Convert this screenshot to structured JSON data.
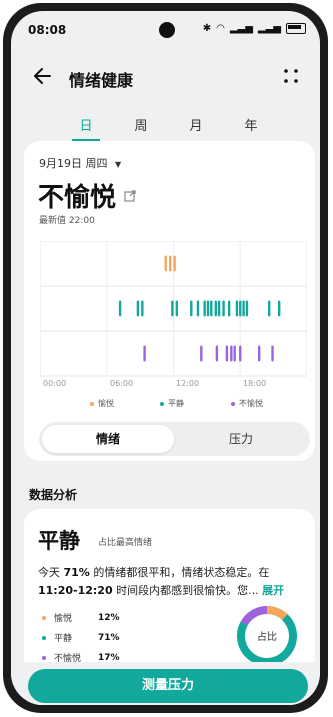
{
  "status_bar": {
    "time": "08:08"
  },
  "header": {
    "title": "情绪健康",
    "back_icon": "arrow-left-icon",
    "more_icon": "more-dots-icon"
  },
  "tabs": [
    {
      "label": "日",
      "active": true
    },
    {
      "label": "周",
      "active": false
    },
    {
      "label": "月",
      "active": false
    },
    {
      "label": "年",
      "active": false
    }
  ],
  "summary": {
    "date": "9月19日 周四",
    "mood": "不愉悦",
    "latest": "最新值 22:00"
  },
  "chart_data": {
    "type": "scatter",
    "x_ticks": [
      "00:00",
      "06:00",
      "12:00",
      "18:00"
    ],
    "series": [
      {
        "name": "愉悦",
        "color": "#f4a65a",
        "times_hours": [
          11.3,
          11.7,
          12.1
        ]
      },
      {
        "name": "平静",
        "color": "#12a89b",
        "times_hours": [
          7.2,
          8.8,
          9.2,
          11.9,
          12.3,
          13.6,
          14.2,
          14.8,
          15.1,
          15.4,
          15.8,
          16.1,
          16.5,
          17.0,
          17.7,
          18.0,
          18.3,
          18.6,
          20.6,
          21.5
        ]
      },
      {
        "name": "不愉悦",
        "color": "#9b63dc",
        "times_hours": [
          9.4,
          14.5,
          15.9,
          16.8,
          17.2,
          17.5,
          18.0,
          19.7,
          20.9
        ]
      }
    ]
  },
  "legend": [
    {
      "label": "愉悦",
      "color": "#f4a65a"
    },
    {
      "label": "平静",
      "color": "#12a89b"
    },
    {
      "label": "不愉悦",
      "color": "#9b63dc"
    }
  ],
  "toggle": {
    "active": "情绪",
    "other": "压力"
  },
  "analysis": {
    "section_title": "数据分析",
    "headline": "平静",
    "headline_sub": "占比最高情绪",
    "desc_1": "今天",
    "desc_pct": "71%",
    "desc_2": "的情绪都很平和，情绪状态稳定。在",
    "desc_range": "11:20-12:20",
    "desc_3": "时间段内都感到很愉快。您...",
    "expand": "展开",
    "stats": [
      {
        "label": "愉悦",
        "value": "12%",
        "color": "#f4a65a"
      },
      {
        "label": "平静",
        "value": "71%",
        "color": "#12a89b"
      },
      {
        "label": "不愉悦",
        "value": "17%",
        "color": "#9b63dc"
      }
    ],
    "donut_center": "占比"
  },
  "measure_button": "测量压力",
  "accent_color": "#12a89b"
}
